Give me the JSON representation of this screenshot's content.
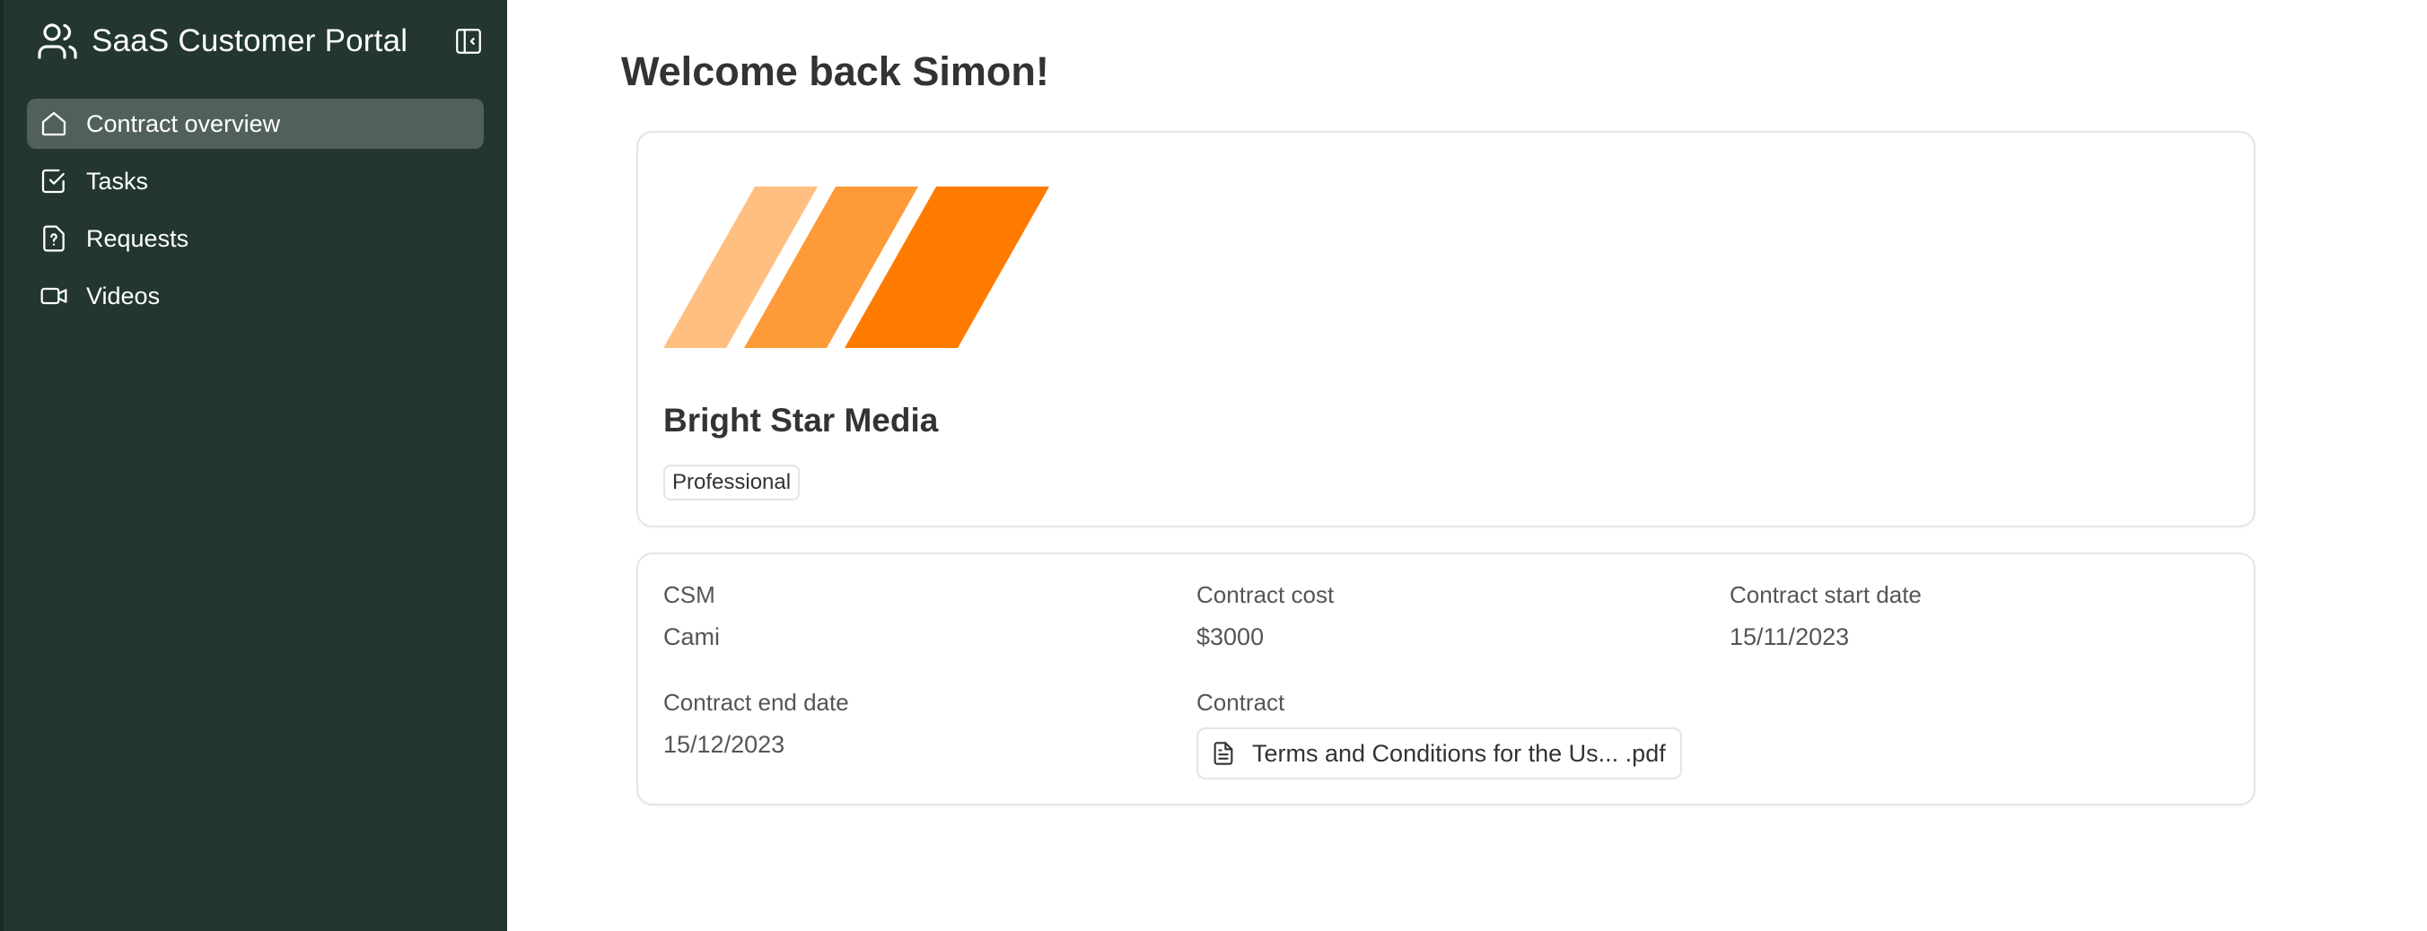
{
  "app": {
    "title": "SaaS Customer Portal"
  },
  "sidebar": {
    "items": [
      {
        "label": "Contract overview",
        "icon": "home-icon",
        "active": true
      },
      {
        "label": "Tasks",
        "icon": "checkbox-icon",
        "active": false
      },
      {
        "label": "Requests",
        "icon": "file-question-icon",
        "active": false
      },
      {
        "label": "Videos",
        "icon": "video-icon",
        "active": false
      }
    ]
  },
  "main": {
    "greeting": "Welcome back Simon!",
    "company": {
      "name": "Bright Star Media",
      "plan": "Professional",
      "logo_colors": [
        "#ffbf80",
        "#ff9a38",
        "#ff7b00"
      ]
    },
    "details": {
      "csm_label": "CSM",
      "csm_value": "Cami",
      "cost_label": "Contract cost",
      "cost_value": "$3000",
      "start_label": "Contract start date",
      "start_value": "15/11/2023",
      "end_label": "Contract end date",
      "end_value": "15/12/2023",
      "contract_label": "Contract",
      "contract_file": "Terms and Conditions for the Us... .pdf"
    }
  },
  "colors": {
    "sidebar_bg": "#233631",
    "sidebar_active": "#516159",
    "text": "#333333"
  }
}
